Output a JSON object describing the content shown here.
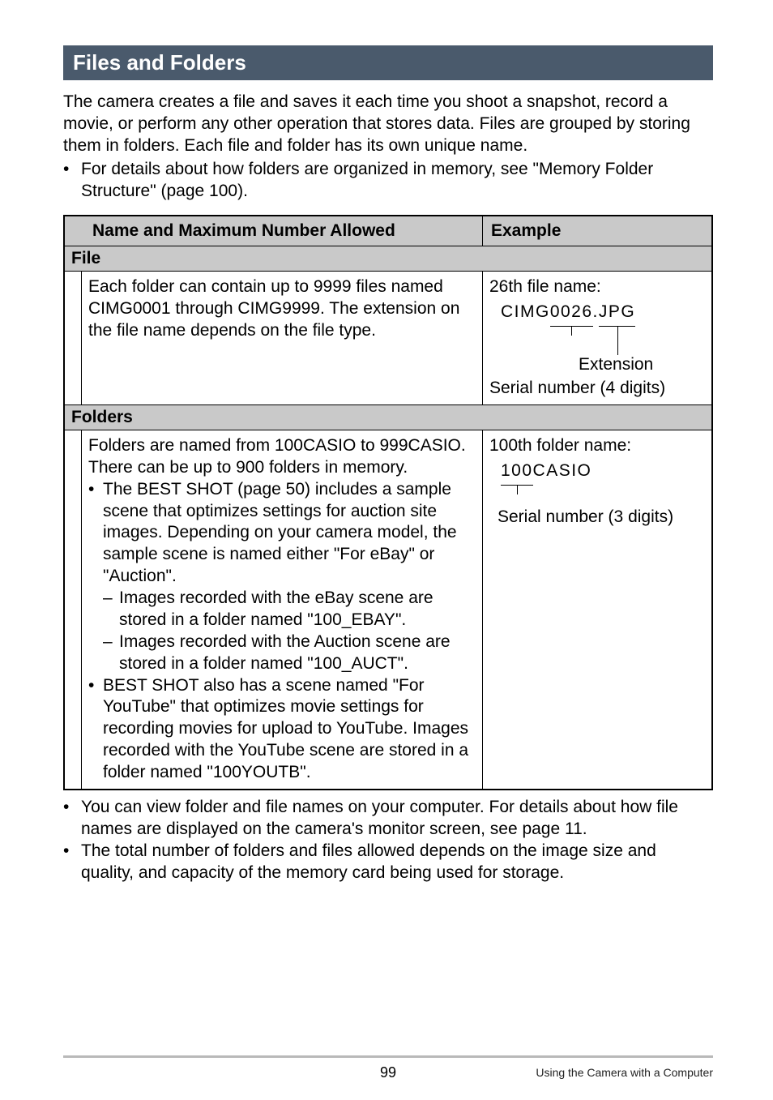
{
  "section_title": "Files and Folders",
  "intro": "The camera creates a file and saves it each time you shoot a snapshot, record a movie, or perform any other operation that stores data. Files are grouped by storing them in folders. Each file and folder has its own unique name.",
  "intro_bullet": "For details about how folders are organized in memory, see \"Memory Folder Structure\" (page 100).",
  "table": {
    "col_name": "Name and Maximum Number Allowed",
    "col_example": "Example",
    "file_label": "File",
    "file_desc": "Each folder can contain up to 9999 files named CIMG0001 through CIMG9999. The extension on the file name depends on the file type.",
    "file_example_lead": "26th file name:",
    "file_example_name_prefix": "CIMG",
    "file_example_name_serial": "0026",
    "file_example_name_dot": ".",
    "file_example_name_ext": "JPG",
    "file_anno_ext": "Extension",
    "file_anno_serial": "Serial number (4 digits)",
    "folders_label": "Folders",
    "folders_desc_1": "Folders are named from 100CASIO to 999CASIO.",
    "folders_desc_2": "There can be up to 900 folders in memory.",
    "folders_bullet_1": "The BEST SHOT (page 50) includes a sample scene that optimizes settings for auction site images. Depending on your camera model, the sample scene is named either \"For eBay\" or \"Auction\".",
    "folders_dash_1a": "Images recorded with the eBay scene are",
    "folders_dash_1a_cont": "stored in a folder named \"100_EBAY\".",
    "folders_dash_1b": "Images recorded with the Auction scene are",
    "folders_dash_1b_cont": "stored in a folder named \"100_AUCT\".",
    "folders_bullet_2": "BEST SHOT also has a scene named \"For YouTube\" that optimizes movie settings for recording movies for upload to YouTube. Images recorded with the YouTube scene are stored in a folder named \"100YOUTB\".",
    "folders_example_lead": "100th folder name:",
    "folders_example_serial": "100",
    "folders_example_rest": "CASIO",
    "folders_anno": "Serial number (3 digits)"
  },
  "after_bullet_1": "You can view folder and file names on your computer. For details about how file names are displayed on the camera's monitor screen, see page 11.",
  "after_bullet_2": "The total number of folders and files allowed depends on the image size and quality, and capacity of the memory card being used for storage.",
  "footer": {
    "page": "99",
    "right": "Using the Camera with a Computer"
  }
}
